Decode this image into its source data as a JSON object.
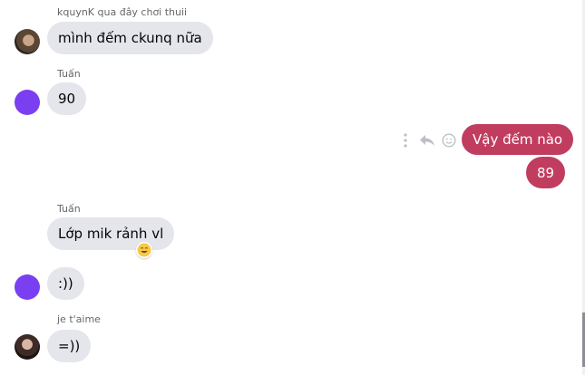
{
  "messages": [
    {
      "sender": "kquynK qua đây chơi thuii",
      "text": "mình đếm ckunq nữa"
    },
    {
      "sender": "Tuấn",
      "text": "90"
    },
    {
      "text": "Vậy đếm nào"
    },
    {
      "text": "89"
    },
    {
      "sender": "Tuấn",
      "text": "Lớp mik rảnh vl",
      "reaction": "grinning-face"
    },
    {
      "text": ":))"
    },
    {
      "sender": "je t'aime",
      "text": "=))"
    }
  ],
  "colors": {
    "incoming_bubble": "#e4e6eb",
    "outgoing_bubble": "#c13d5f",
    "avatar_purple": "#7b3ff2"
  },
  "icons": [
    "more-options-icon",
    "reply-icon",
    "react-icon"
  ]
}
